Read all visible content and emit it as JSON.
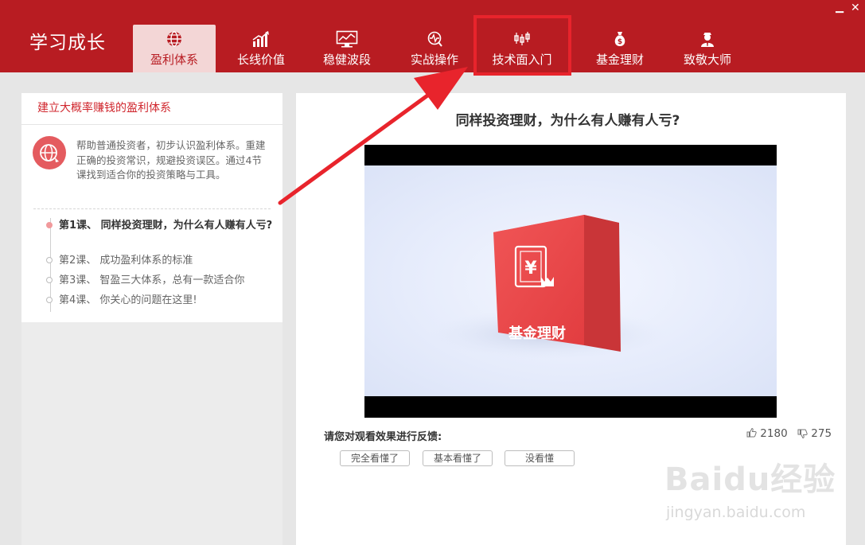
{
  "app": {
    "title": "学习成长",
    "minimize_label": "▁",
    "close_label": "✕"
  },
  "nav": {
    "tabs": [
      {
        "label": "盈利体系",
        "icon": "globe-dollar-icon",
        "active": true
      },
      {
        "label": "长线价值",
        "icon": "rising-chart-icon",
        "active": false
      },
      {
        "label": "稳健波段",
        "icon": "monitor-chart-icon",
        "active": false
      },
      {
        "label": "实战操作",
        "icon": "target-pulse-icon",
        "active": false
      },
      {
        "label": "技术面入门",
        "icon": "candlestick-icon",
        "active": false
      },
      {
        "label": "基金理财",
        "icon": "money-bag-icon",
        "active": false
      },
      {
        "label": "致敬大师",
        "icon": "master-person-icon",
        "active": false
      }
    ]
  },
  "sidebar": {
    "header": "建立大概率赚钱的盈利体系",
    "intro_icon": "globe-arrow-icon",
    "intro": "帮助普通投资者，初步认识盈利体系。重建正确的投资常识，规避投资误区。通过4节课找到适合你的投资策略与工具。",
    "lessons": [
      {
        "label": "第1课、 同样投资理财，为什么有人赚有人亏?",
        "active": true
      },
      {
        "label": "第2课、 成功盈利体系的标准",
        "active": false
      },
      {
        "label": "第3课、 智盈三大体系，总有一款适合你",
        "active": false
      },
      {
        "label": "第4课、 你关心的问题在这里!",
        "active": false
      }
    ]
  },
  "main": {
    "title": "同样投资理财，为什么有人赚有人亏?",
    "video": {
      "cube_label": "基金理财",
      "cube_icon": "yen-crown-icon"
    },
    "feedback": {
      "label": "请您对观看效果进行反馈:",
      "likes": "2180",
      "dislikes": "275",
      "buttons": [
        "完全看懂了",
        "基本看懂了",
        "没看懂"
      ]
    }
  },
  "watermark": {
    "text": "Baidu经验",
    "url": "jingyan.baidu.com"
  },
  "colors": {
    "brand_red": "#b81c22",
    "active_tab_bg": "#f3d6d6",
    "highlight_red": "#e8242c",
    "cube_red": "#ea4a4c"
  }
}
